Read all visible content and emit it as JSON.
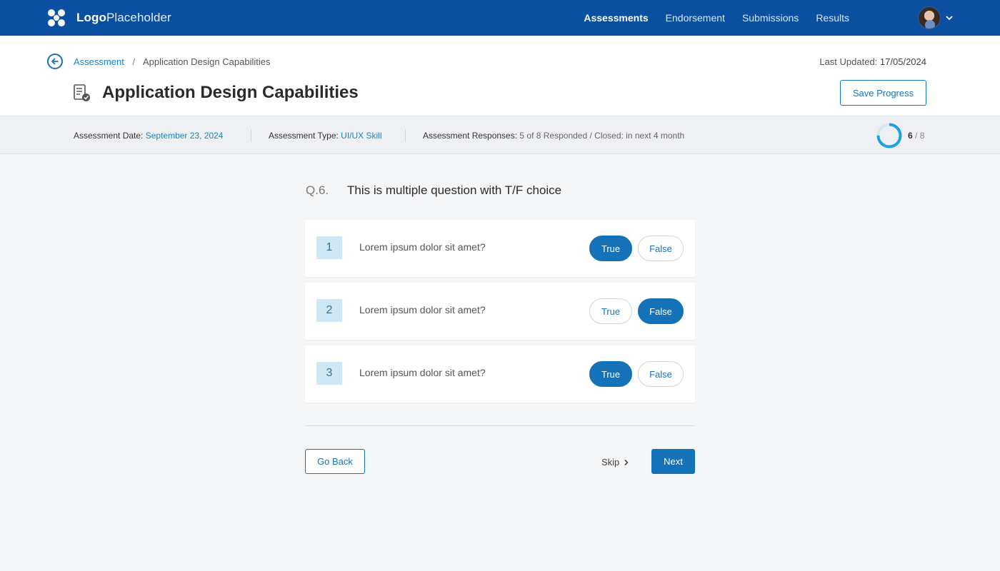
{
  "brand": {
    "logo_bold": "Logo",
    "logo_light": "Placeholder"
  },
  "nav": {
    "items": [
      "Assessments",
      "Endorsement",
      "Submissions",
      "Results"
    ],
    "active": "Assessments"
  },
  "breadcrumb": {
    "link": "Assessment",
    "separator": "/",
    "current": "Application Design Capabilities"
  },
  "last_updated": {
    "label": "Last Updated:",
    "value": "17/05/2024"
  },
  "page": {
    "title": "Application Design Capabilities",
    "save_label": "Save Progress"
  },
  "info": {
    "date_label": "Assessment Date:",
    "date_value": "September 23, 2024",
    "type_label": "Assessment Type:",
    "type_value": "UI/UX Skill",
    "responses_label": "Assessment Responses:",
    "responses_value": "5 of 8 Responded / Closed: in next 4 month"
  },
  "progress": {
    "current": "6",
    "separator": "/",
    "total": "8",
    "fraction": 0.75
  },
  "question": {
    "number": "Q.6.",
    "title": "This is multiple question with T/F choice",
    "statements": [
      {
        "index": "1",
        "text": "Lorem ipsum dolor sit amet?",
        "answer": "True"
      },
      {
        "index": "2",
        "text": "Lorem ipsum dolor sit amet?",
        "answer": "False"
      },
      {
        "index": "3",
        "text": "Lorem ipsum dolor sit amet?",
        "answer": "True"
      }
    ],
    "true_label": "True",
    "false_label": "False"
  },
  "footer": {
    "back_label": "Go Back",
    "skip_label": "Skip",
    "next_label": "Next"
  },
  "colors": {
    "nav_bg": "#0b4fa1",
    "accent": "#1472b9",
    "link": "#1a85c5",
    "badge_bg": "#cfe8f5"
  }
}
